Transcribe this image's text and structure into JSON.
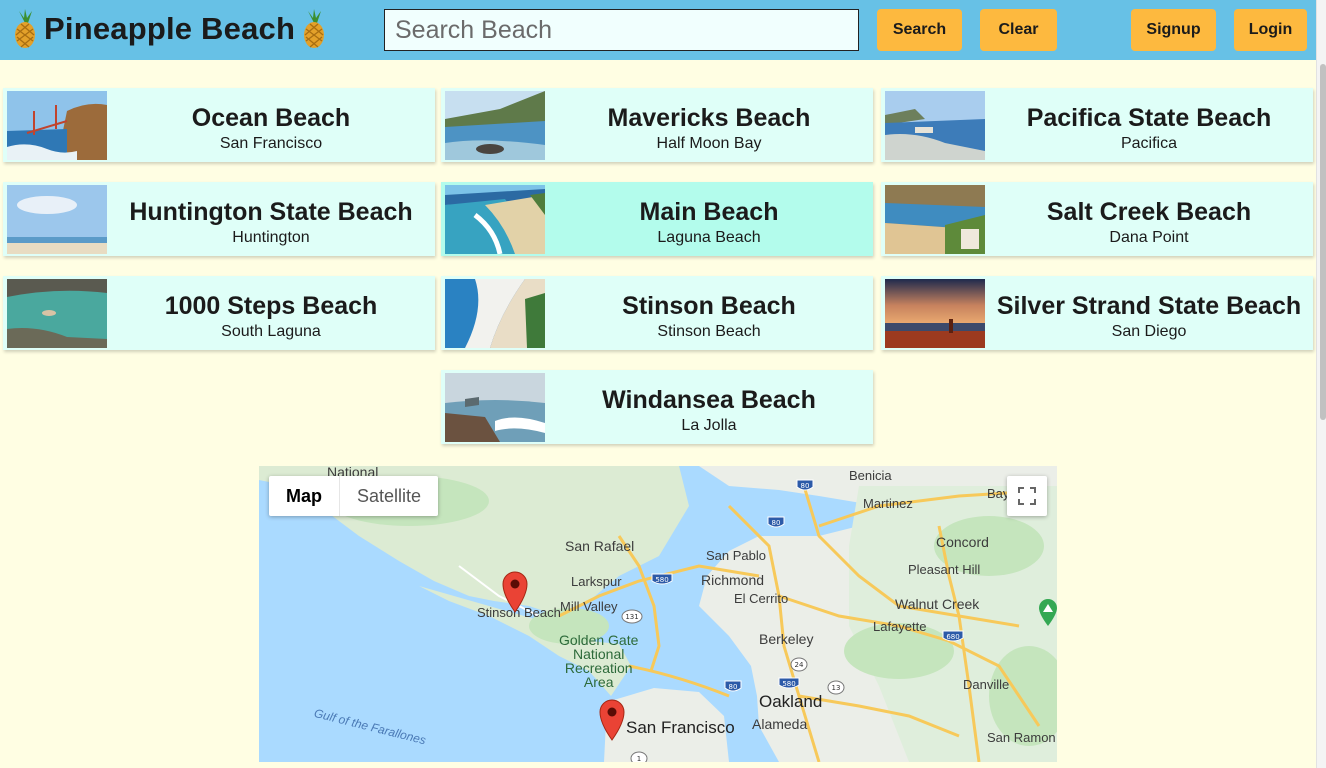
{
  "header": {
    "title": "Pineapple Beach",
    "search_placeholder": "Search Beach",
    "search_button": "Search",
    "clear_button": "Clear",
    "signup_button": "Signup",
    "login_button": "Login",
    "background_color": "#67c1e6",
    "button_color": "#fdb93f"
  },
  "beaches": [
    {
      "name": "Ocean Beach",
      "city": "San Francisco"
    },
    {
      "name": "Mavericks Beach",
      "city": "Half Moon Bay"
    },
    {
      "name": "Pacifica State Beach",
      "city": "Pacifica"
    },
    {
      "name": "Huntington State Beach",
      "city": "Huntington"
    },
    {
      "name": "Main Beach",
      "city": "Laguna Beach"
    },
    {
      "name": "Salt Creek Beach",
      "city": "Dana Point"
    },
    {
      "name": "1000 Steps Beach",
      "city": "South Laguna"
    },
    {
      "name": "Stinson Beach",
      "city": "Stinson Beach"
    },
    {
      "name": "Silver Strand State Beach",
      "city": "San Diego"
    },
    {
      "name": "Windansea Beach",
      "city": "La Jolla"
    }
  ],
  "map": {
    "map_label": "Map",
    "satellite_label": "Satellite",
    "selected_type": "Map",
    "places": {
      "national": "National",
      "benicia": "Benicia",
      "martinez": "Martinez",
      "bay_point": "Bay Pt",
      "concord": "Concord",
      "san_rafael": "San Rafael",
      "san_pablo": "San Pablo",
      "richmond": "Richmond",
      "pleasant_hill": "Pleasant Hill",
      "larkspur": "Larkspur",
      "stinson_beach": "Stinson Beach",
      "mill_valley": "Mill Valley",
      "el_cerrito": "El Cerrito",
      "walnut_creek": "Walnut Creek",
      "lafayette": "Lafayette",
      "golden_gate": "Golden Gate\nNational\nRecreation\nArea",
      "berkeley": "Berkeley",
      "oakland": "Oakland",
      "danville": "Danville",
      "gulf": "Gulf of the Farallones",
      "alameda": "Alameda",
      "san_francisco": "San Francisco",
      "san_ramon": "San Ramon"
    },
    "route_shields": [
      "80",
      "80",
      "580",
      "131",
      "680",
      "24",
      "580",
      "80",
      "13",
      "1"
    ]
  }
}
